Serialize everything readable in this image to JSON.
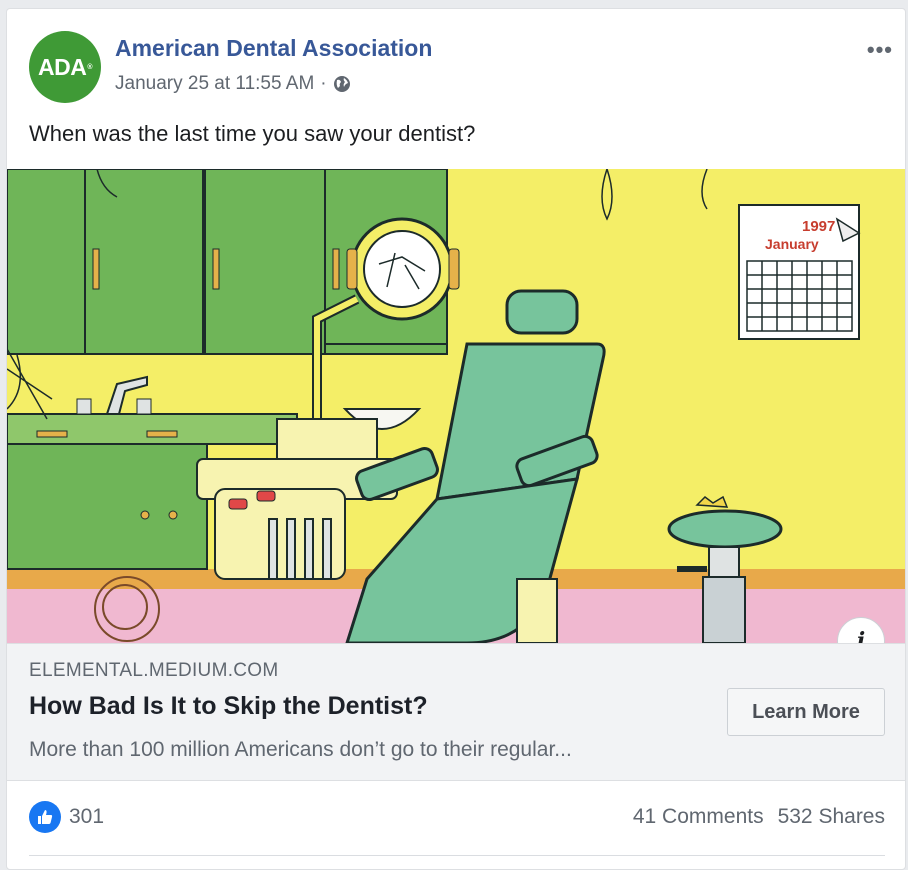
{
  "post": {
    "page_name": "American Dental Association",
    "avatar_text": "ADA",
    "avatar_mark": "®",
    "timestamp": "January 25 at 11:55 AM",
    "meta_separator": "·",
    "audience_icon": "globe-icon",
    "more_icon": "•••",
    "text": "When was the last time you saw your dentist?"
  },
  "illustration": {
    "calendar_year": "1997",
    "calendar_month": "January",
    "info_icon": "i"
  },
  "link": {
    "domain": "ELEMENTAL.MEDIUM.COM",
    "title": "How Bad Is It to Skip the Dentist?",
    "description": "More than 100 million Americans don’t go to their regular...",
    "cta_label": "Learn More"
  },
  "engagement": {
    "like_count": "301",
    "comments": "41 Comments",
    "shares": "532 Shares"
  },
  "colors": {
    "brand_green": "#3f9a36",
    "page_name_blue": "#385898",
    "like_blue": "#1877f2"
  }
}
